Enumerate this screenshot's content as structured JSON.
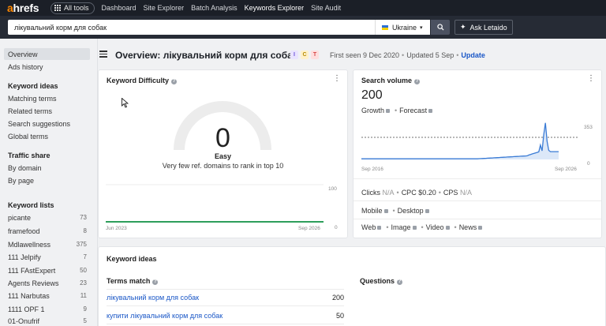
{
  "nav": {
    "logo_a": "a",
    "logo_rest": "hrefs",
    "all_tools": "All tools",
    "links": [
      {
        "label": "Dashboard"
      },
      {
        "label": "Site Explorer"
      },
      {
        "label": "Batch Analysis"
      },
      {
        "label": "Keywords Explorer"
      },
      {
        "label": "Site Audit"
      }
    ]
  },
  "search": {
    "value": "лікувальний корм для собак",
    "country": "Ukraine",
    "ask_label": "Ask Letaido",
    "icons": {
      "search": "search-icon",
      "ask": "sparkle-icon"
    }
  },
  "sidebar": {
    "top_items": [
      {
        "label": "Overview"
      },
      {
        "label": "Ads history"
      }
    ],
    "keyword_ideas_head": "Keyword ideas",
    "keyword_ideas": [
      {
        "label": "Matching terms"
      },
      {
        "label": "Related terms"
      },
      {
        "label": "Search suggestions"
      },
      {
        "label": "Global terms"
      }
    ],
    "traffic_head": "Traffic share",
    "traffic": [
      {
        "label": "By domain"
      },
      {
        "label": "By page"
      }
    ],
    "lists_head": "Keyword lists",
    "lists": [
      {
        "label": "picante",
        "count": "73"
      },
      {
        "label": "framefood",
        "count": "8"
      },
      {
        "label": "Mdlawellness",
        "count": "375"
      },
      {
        "label": "111 Jelpify",
        "count": "7"
      },
      {
        "label": "111 FAstExpert",
        "count": "50"
      },
      {
        "label": "Agents Reviews",
        "count": "23"
      },
      {
        "label": "111 Narbutas",
        "count": "11"
      },
      {
        "label": "1111 OPF 1",
        "count": "9"
      },
      {
        "label": "01-Onufrif",
        "count": "5"
      }
    ]
  },
  "header": {
    "title": "Overview: лікувальний корм для собак",
    "intents": [
      {
        "letter": "I",
        "bg": "#e9e3ff",
        "fg": "#6b4fd8"
      },
      {
        "letter": "C",
        "bg": "#fff1c9",
        "fg": "#b58a00"
      },
      {
        "letter": "T",
        "bg": "#ffdede",
        "fg": "#d64545"
      }
    ],
    "first_seen": "First seen 9 Dec 2020",
    "updated": "Updated 5 Sep",
    "update_link": "Update"
  },
  "kd_card": {
    "title": "Keyword Difficulty",
    "value": "0",
    "label": "Easy",
    "description": "Very few ref. domains to rank in top 10",
    "axis_max": "100",
    "axis_min": "0",
    "x_start": "Jun 2023",
    "x_end": "Sep 2026",
    "accent": "#2e9e5b"
  },
  "sv_card": {
    "title": "Search volume",
    "value": "200",
    "growth": "Growth",
    "forecast": "Forecast",
    "y_max": "353",
    "y_min": "0",
    "x_start": "Sep 2016",
    "x_end": "Sep 2026",
    "clicks_label": "Clicks",
    "clicks_val": "N/A",
    "cpc_label": "CPC",
    "cpc_val": "$0.20",
    "cps_label": "CPS",
    "cps_val": "N/A",
    "devices": [
      "Mobile",
      "Desktop"
    ],
    "serp": [
      "Web",
      "Image",
      "Video",
      "News"
    ],
    "line_color": "#3a7bd5"
  },
  "keyword_ideas": {
    "title": "Keyword ideas",
    "terms_head": "Terms match",
    "questions_head": "Questions",
    "rows": [
      {
        "keyword": "лікувальний корм для собак",
        "volume": "200"
      },
      {
        "keyword": "купити лікувальний корм для собак",
        "volume": "50"
      }
    ]
  }
}
